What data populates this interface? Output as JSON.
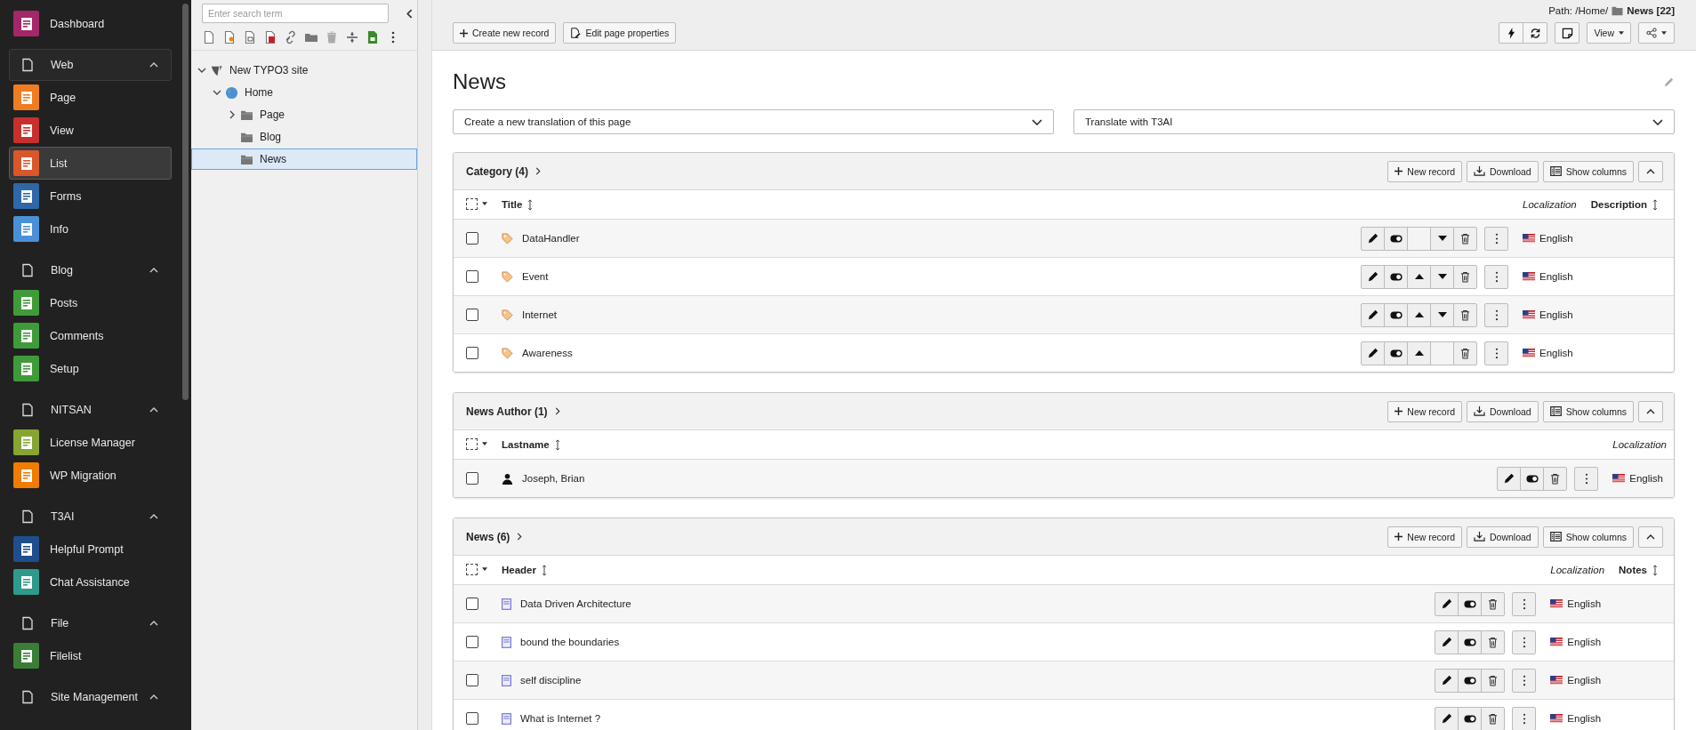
{
  "sidebar": {
    "modules": [
      {
        "kind": "module",
        "label": "Dashboard",
        "color": "#a4276a",
        "selected": false
      },
      {
        "kind": "group",
        "label": "Web",
        "expanded": true,
        "selected": true,
        "children": [
          {
            "label": "Page",
            "color": "#f07c22",
            "selected": false
          },
          {
            "label": "View",
            "color": "#c8302c",
            "selected": false
          },
          {
            "label": "List",
            "color": "#d9572b",
            "selected": true
          },
          {
            "label": "Forms",
            "color": "#2f67a8",
            "selected": false
          },
          {
            "label": "Info",
            "color": "#4a90d9",
            "selected": false
          }
        ]
      },
      {
        "kind": "group",
        "label": "Blog",
        "expanded": true,
        "selected": false,
        "children": [
          {
            "label": "Posts",
            "color": "#3f9b3a",
            "selected": false
          },
          {
            "label": "Comments",
            "color": "#3f9b3a",
            "selected": false
          },
          {
            "label": "Setup",
            "color": "#3f9b3a",
            "selected": false
          }
        ]
      },
      {
        "kind": "group",
        "label": "NITSAN",
        "expanded": true,
        "selected": false,
        "children": [
          {
            "label": "License Manager",
            "color": "#86a531",
            "selected": false
          },
          {
            "label": "WP Migration",
            "color": "#f07c00",
            "selected": false
          }
        ]
      },
      {
        "kind": "group",
        "label": "T3AI",
        "expanded": true,
        "selected": false,
        "children": [
          {
            "label": "Helpful Prompt",
            "color": "#1f4e8c",
            "selected": false
          },
          {
            "label": "Chat Assistance",
            "color": "#2f9a8c",
            "selected": false
          }
        ]
      },
      {
        "kind": "group",
        "label": "File",
        "expanded": true,
        "selected": false,
        "children": [
          {
            "label": "Filelist",
            "color": "#3a7d36",
            "selected": false
          }
        ]
      },
      {
        "kind": "group",
        "label": "Site Management",
        "expanded": true,
        "selected": false
      }
    ]
  },
  "page_tree": {
    "search": {
      "placeholder": "Enter search term"
    },
    "nodes": [
      {
        "kind": "site",
        "label": "New TYPO3 site",
        "expanded": true,
        "selected": false,
        "children": [
          {
            "kind": "home",
            "label": "Home",
            "expanded": true,
            "selected": false,
            "children": [
              {
                "kind": "folder",
                "label": "Page",
                "expanded": false,
                "selected": false
              },
              {
                "kind": "folder",
                "label": "Blog",
                "selected": false
              },
              {
                "kind": "folder",
                "label": "News",
                "selected": true
              }
            ]
          }
        ]
      }
    ]
  },
  "content": {
    "toolbar": {
      "buttons": [
        "Create new record",
        "Edit page properties"
      ],
      "path_prefix": "Path: /Home/",
      "path_page": "News [22]",
      "view_button": "View"
    },
    "page_title": "News",
    "selects": [
      {
        "value": "Create a new translation of this page"
      },
      {
        "value": "Translate with T3AI"
      }
    ],
    "tables": [
      {
        "title": "Category (4)",
        "buttons": [
          "New record",
          "Download",
          "Show columns"
        ],
        "expanded": true,
        "all_checked": false,
        "columns": {
          "title": "Title",
          "localization": "Localization",
          "extra": "Description"
        },
        "rows": [
          {
            "kind": "category",
            "title": "DataHandler",
            "checked": false,
            "move_up": false,
            "move_down": true,
            "language": "English"
          },
          {
            "kind": "category",
            "title": "Event",
            "checked": false,
            "move_up": true,
            "move_down": true,
            "language": "English"
          },
          {
            "kind": "category",
            "title": "Internet",
            "checked": false,
            "move_up": true,
            "move_down": true,
            "language": "English"
          },
          {
            "kind": "category",
            "title": "Awareness",
            "checked": false,
            "move_up": true,
            "move_down": false,
            "language": "English"
          }
        ]
      },
      {
        "title": "News Author (1)",
        "buttons": [
          "New record",
          "Download",
          "Show columns"
        ],
        "expanded": true,
        "all_checked": false,
        "columns": {
          "title": "Lastname",
          "localization": "Localization"
        },
        "rows": [
          {
            "kind": "author",
            "title": "Joseph, Brian",
            "checked": false,
            "language": "English"
          }
        ]
      },
      {
        "title": "News (6)",
        "buttons": [
          "New record",
          "Download",
          "Show columns"
        ],
        "expanded": true,
        "all_checked": false,
        "columns": {
          "title": "Header",
          "localization": "Localization",
          "extra": "Notes"
        },
        "rows": [
          {
            "kind": "news",
            "title": "Data Driven Architecture",
            "checked": false,
            "language": "English"
          },
          {
            "kind": "news",
            "title": "bound the boundaries",
            "checked": false,
            "language": "English"
          },
          {
            "kind": "news",
            "title": "self discipline",
            "checked": false,
            "language": "English"
          },
          {
            "kind": "news",
            "title": "What is Internet ?",
            "checked": false,
            "language": "English"
          }
        ]
      }
    ]
  }
}
